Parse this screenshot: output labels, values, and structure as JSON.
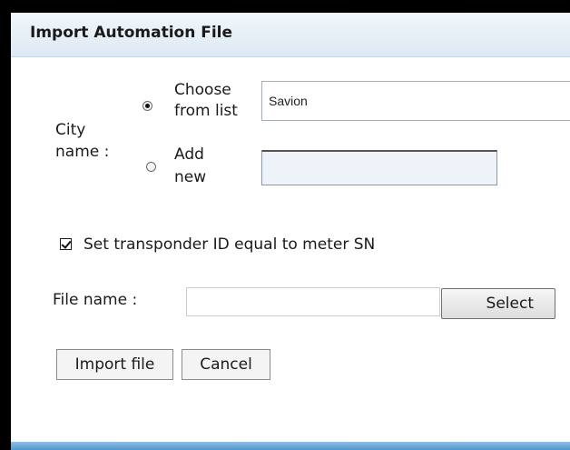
{
  "dialog": {
    "title": "Import Automation File"
  },
  "city": {
    "label_line1": "City",
    "label_line2": "name :",
    "choose_line1": "Choose",
    "choose_line2": "from list",
    "add_line1": "Add",
    "add_line2": "new",
    "selected_city": "Savion",
    "new_city_value": ""
  },
  "transponder": {
    "label": "Set transponder ID equal to meter SN",
    "checked": true
  },
  "file": {
    "label": "File name :",
    "value": "",
    "select_label": "Select"
  },
  "actions": {
    "import_label": "Import file",
    "cancel_label": "Cancel"
  },
  "colors": {
    "titlebar": "#dde9f3",
    "bottombar": "#4e98d2"
  }
}
